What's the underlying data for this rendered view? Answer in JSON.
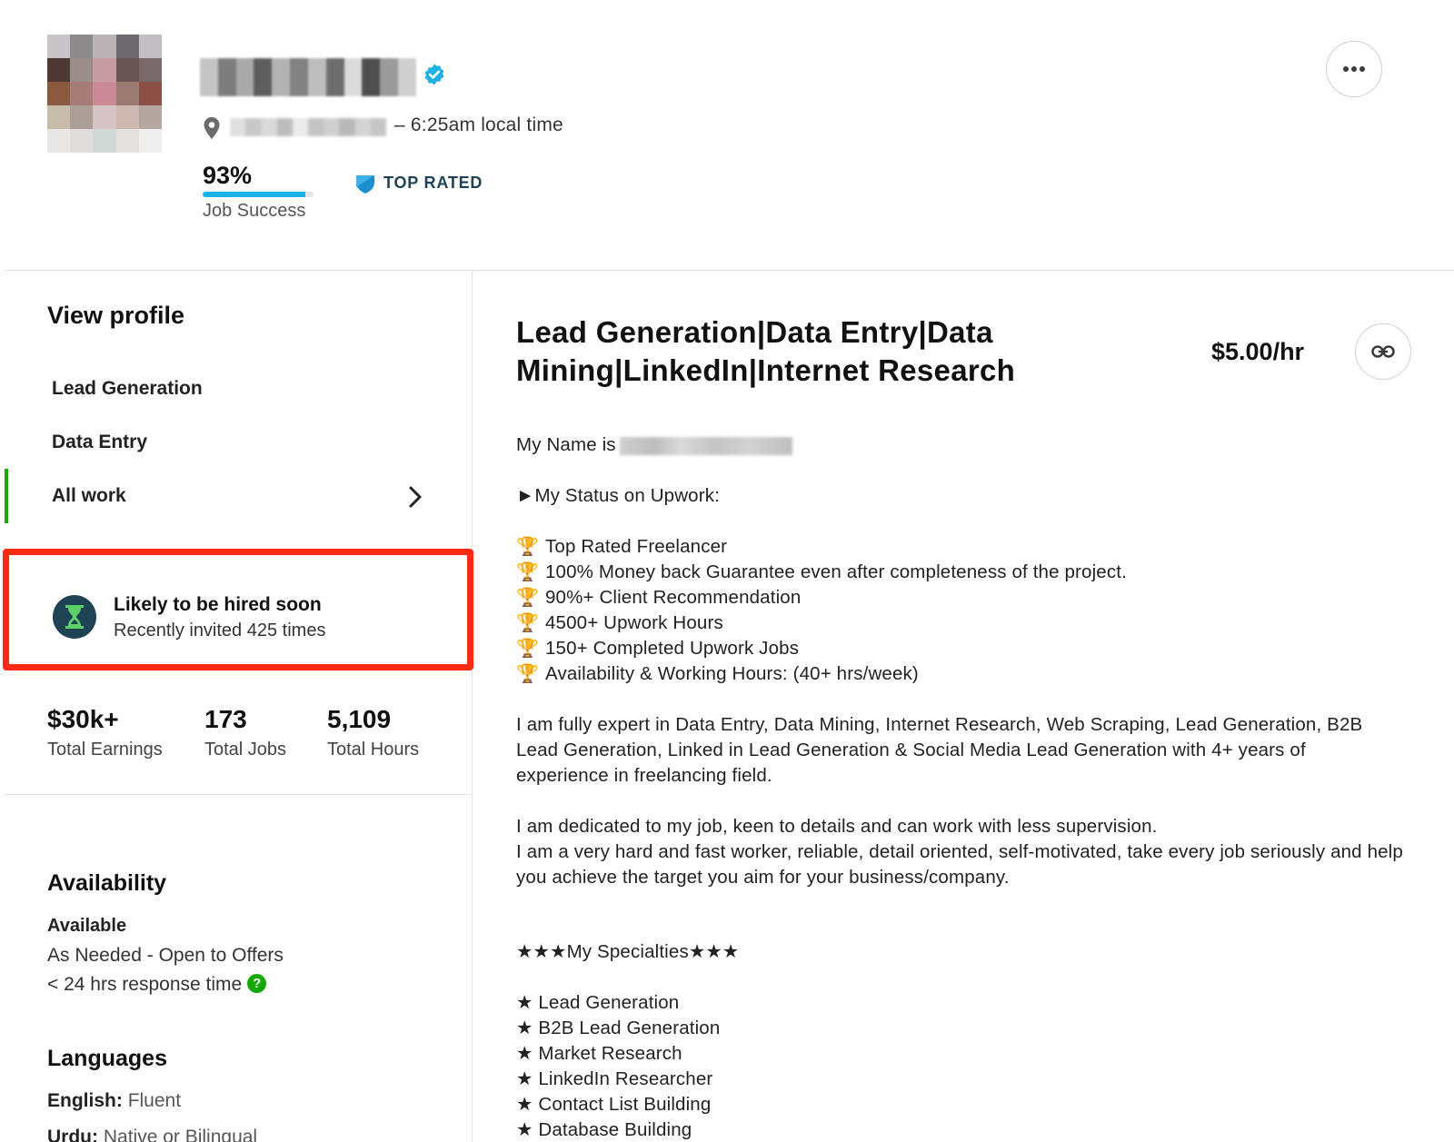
{
  "header": {
    "local_time": "– 6:25am local time",
    "job_success_value": "93%",
    "job_success_fraction": 0.93,
    "job_success_label": "Job Success",
    "badge_label": "TOP RATED"
  },
  "sidebar": {
    "title": "View profile",
    "nav_items": [
      {
        "label": "Lead Generation"
      },
      {
        "label": "Data Entry"
      },
      {
        "label": "All work"
      }
    ],
    "hired_card": {
      "title": "Likely to be hired soon",
      "subtitle": "Recently invited 425 times"
    },
    "stats": [
      {
        "value": "$30k+",
        "label": "Total Earnings"
      },
      {
        "value": "173",
        "label": "Total Jobs"
      },
      {
        "value": "5,109",
        "label": "Total Hours"
      }
    ],
    "availability": {
      "title": "Availability",
      "status": "Available",
      "detail": "As Needed - Open to Offers",
      "response": "< 24 hrs response time",
      "help_glyph": "?"
    },
    "languages": {
      "title": "Languages",
      "items": [
        {
          "name": "English:",
          "level": "Fluent"
        },
        {
          "name": "Urdu:",
          "level": "Native or Bilingual"
        }
      ]
    }
  },
  "main": {
    "title": "Lead Generation|Data Entry|Data Mining|LinkedIn|Internet Research",
    "rate": "$5.00/hr",
    "desc": {
      "name_prefix": "My Name is",
      "status_heading": "►My Status on Upwork:",
      "status_items": [
        "Top Rated Freelancer",
        "100% Money back Guarantee even after completeness of the project.",
        "90%+ Client Recommendation",
        "4500+ Upwork Hours",
        "150+ Completed Upwork Jobs",
        "Availability & Working Hours: (40+ hrs/week)"
      ],
      "para1": "I am fully expert in Data Entry, Data Mining, Internet Research, Web Scraping, Lead Generation, B2B Lead Generation, Linked in Lead Generation & Social Media Lead Generation with 4+ years of experience in freelancing field.",
      "para2a": "I am dedicated to my job, keen to details and can work with less supervision.",
      "para2b": "I am a very hard and fast worker, reliable, detail oriented, self-motivated, take every job seriously and help you achieve the target you aim for your business/company.",
      "specialties_heading": "★★★My Specialties★★★",
      "specialties": [
        "★ Lead Generation",
        "★ B2B Lead Generation",
        "★ Market Research",
        "★ LinkedIn Researcher",
        "★ Contact List Building",
        "★ Database Building"
      ]
    }
  },
  "colors": {
    "accent_green": "#14a800",
    "progress_blue": "#1cb2e8",
    "highlight_red": "#ff2a12",
    "badge_navy": "#1d4354"
  }
}
